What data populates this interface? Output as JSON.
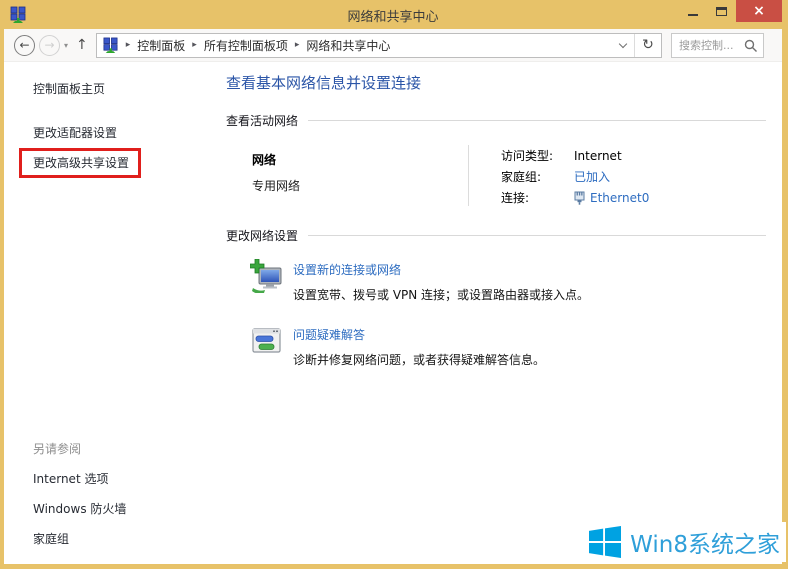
{
  "window": {
    "title": "网络和共享中心"
  },
  "icons": {
    "back": "←",
    "forward": "→",
    "up": "↑",
    "refresh": "↻",
    "crumb_chevron": "▸",
    "nav_caret": "▾",
    "close_glyph": "×"
  },
  "toolbar": {
    "breadcrumb": {
      "items": [
        "控制面板",
        "所有控制面板项",
        "网络和共享中心"
      ]
    },
    "search": {
      "placeholder": "搜索控制..."
    }
  },
  "sidebar": {
    "home": "控制面板主页",
    "tasks": [
      {
        "label": "更改适配器设置",
        "highlighted": false
      },
      {
        "label": "更改高级共享设置",
        "highlighted": true
      }
    ],
    "see_also_header": "另请参阅",
    "see_also": [
      "Internet 选项",
      "Windows 防火墙",
      "家庭组"
    ]
  },
  "main": {
    "title": "查看基本网络信息并设置连接",
    "active": {
      "section_label": "查看活动网络",
      "network": {
        "name": "网络",
        "type": "专用网络",
        "details": [
          {
            "label": "访问类型:",
            "value": "Internet"
          },
          {
            "label": "家庭组:",
            "value": "已加入"
          },
          {
            "label": "连接:",
            "value": "Ethernet0"
          }
        ]
      }
    },
    "change": {
      "section_label": "更改网络设置",
      "items": [
        {
          "title": "设置新的连接或网络",
          "description": "设置宽带、拨号或 VPN 连接；或设置路由器或接入点。"
        },
        {
          "title": "问题疑难解答",
          "description": "诊断并修复网络问题，或者获得疑难解答信息。"
        }
      ]
    }
  },
  "watermark": {
    "text": "Win8系统之家"
  },
  "colors": {
    "titlebar_gold": "#e7c269",
    "close_red": "#c94f44",
    "highlight_red": "#e01f1c",
    "link_blue": "#2d6cc0",
    "heading_blue": "#2b55a7",
    "logo_blue": "#00a2e2",
    "watermark_blue": "#2f9fd9"
  }
}
